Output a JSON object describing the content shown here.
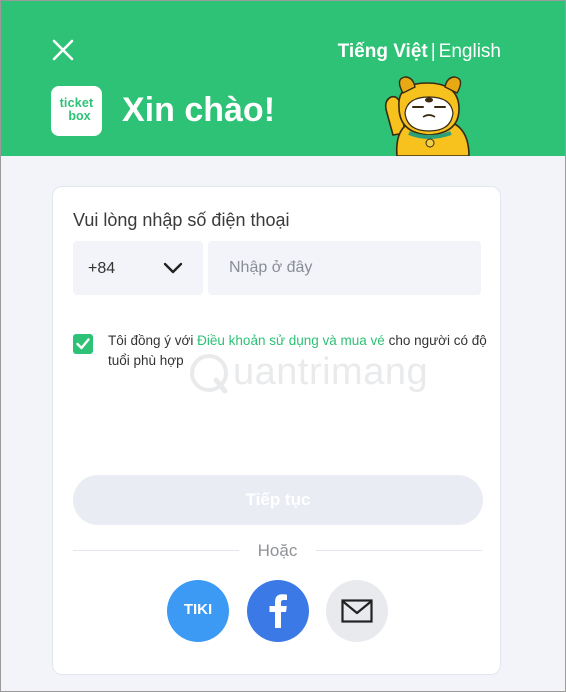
{
  "header": {
    "lang_active": "Tiếng Việt",
    "lang_separator": "|",
    "lang_other": "English",
    "logo_line1": "ticket",
    "logo_line2": "box",
    "greeting": "Xin chào!"
  },
  "form": {
    "phone_label": "Vui lòng nhập số điện thoại",
    "country_code": "+84",
    "phone_placeholder": "Nhập ở đây",
    "terms_prefix": "Tôi đồng ý với ",
    "terms_link": "Điều khoản sử dụng và mua vé",
    "terms_suffix": " cho người có độ tuổi phù hợp",
    "terms_checked": true,
    "continue_label": "Tiếp tục",
    "or_label": "Hoặc"
  },
  "social": {
    "tiki_label": "TIKI"
  },
  "watermark": {
    "text": "uantrimang"
  },
  "colors": {
    "brand_green": "#2dc275",
    "tiki_blue": "#3c9af5",
    "facebook_blue": "#3b79e6"
  },
  "icons": [
    "close-icon",
    "chevron-down-icon",
    "check-icon",
    "facebook-icon",
    "mail-icon"
  ]
}
